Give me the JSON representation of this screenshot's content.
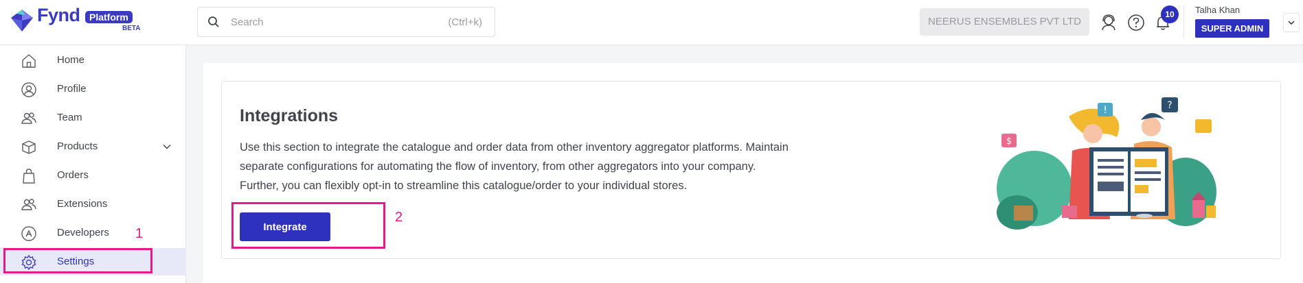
{
  "logo": {
    "wordmark": "Fynd",
    "badge": "Platform",
    "tag": "BETA"
  },
  "search": {
    "placeholder": "Search",
    "shortcut": "(Ctrl+k)"
  },
  "header": {
    "company": "NEERUS ENSEMBLES PVT LTD",
    "notification_count": "10",
    "user_name": "Talha Khan",
    "user_role": "SUPER ADMIN",
    "icons": [
      "support-agent-icon",
      "help-icon",
      "bell-icon",
      "chevron-down-icon"
    ]
  },
  "sidebar": {
    "items": [
      {
        "label": "Home",
        "icon": "home-icon"
      },
      {
        "label": "Profile",
        "icon": "profile-icon"
      },
      {
        "label": "Team",
        "icon": "team-icon"
      },
      {
        "label": "Products",
        "icon": "box-icon",
        "expandable": true
      },
      {
        "label": "Orders",
        "icon": "bag-icon"
      },
      {
        "label": "Extensions",
        "icon": "extensions-icon"
      },
      {
        "label": "Developers",
        "icon": "developers-icon"
      },
      {
        "label": "Settings",
        "icon": "gear-icon",
        "active": true
      }
    ]
  },
  "main": {
    "title": "Integrations",
    "description": "Use this section to integrate the catalogue and order data from other inventory aggregator platforms. Maintain separate configurations for automating the flow of inventory, from other aggregators into your company. Further, you can flexibly opt-in to streamline this catalogue/order to your individual stores.",
    "button_label": "Integrate"
  },
  "annotations": {
    "step1": "1",
    "step2": "2"
  },
  "colors": {
    "accent": "#2e31be",
    "annotation": "#e6198a",
    "active_bg": "#e8e9f8"
  }
}
